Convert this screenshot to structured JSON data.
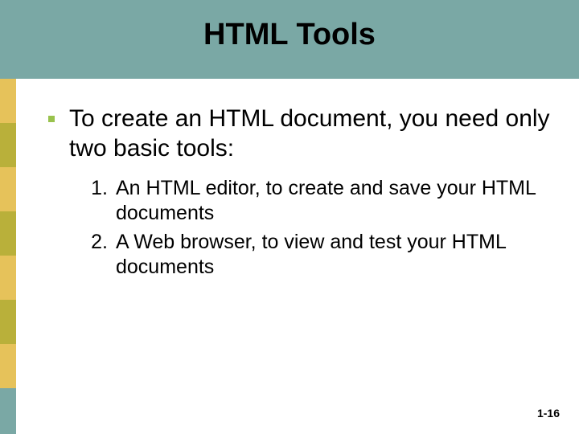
{
  "header": {
    "title": "HTML Tools"
  },
  "bullet": {
    "text": "To create an HTML document, you need only two basic tools:"
  },
  "numbered": [
    {
      "n": "1.",
      "text": "An HTML editor, to create and save your HTML documents"
    },
    {
      "n": "2.",
      "text": "A Web browser, to view and test your HTML documents"
    }
  ],
  "footer": {
    "page": "1-16"
  },
  "accent_colors": {
    "header_bg": "#7aa8a5",
    "bullet_green": "#99c24d",
    "stripe1": "#e6c25a",
    "stripe2": "#b9b03a"
  }
}
